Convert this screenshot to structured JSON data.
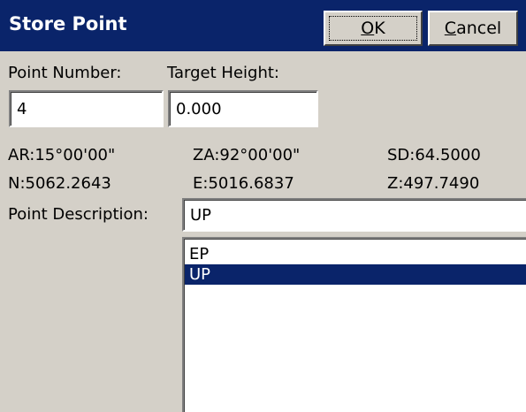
{
  "window": {
    "title": "Store Point",
    "ok_label": "OK",
    "ok_accel": "O",
    "ok_rest": "K",
    "cancel_label": "Cancel",
    "cancel_accel": "C",
    "cancel_rest": "ancel"
  },
  "form": {
    "point_number": {
      "label": "Point Number:",
      "value": "4"
    },
    "target_height": {
      "label": "Target Height:",
      "value": "0.000"
    }
  },
  "readings": {
    "ar": "AR:15°00'00\"",
    "za": "ZA:92°00'00\"",
    "sd": "SD:64.5000",
    "n": "N:5062.2643",
    "e": "E:5016.6837",
    "z": "Z:497.7490"
  },
  "description": {
    "label": "Point Description:",
    "value": "UP",
    "options": [
      {
        "label": "EP",
        "selected": false
      },
      {
        "label": "UP",
        "selected": true
      }
    ]
  },
  "colors": {
    "title_bar": "#0a246a",
    "dialog_face": "#d4d0c8",
    "selection": "#0a246a"
  }
}
